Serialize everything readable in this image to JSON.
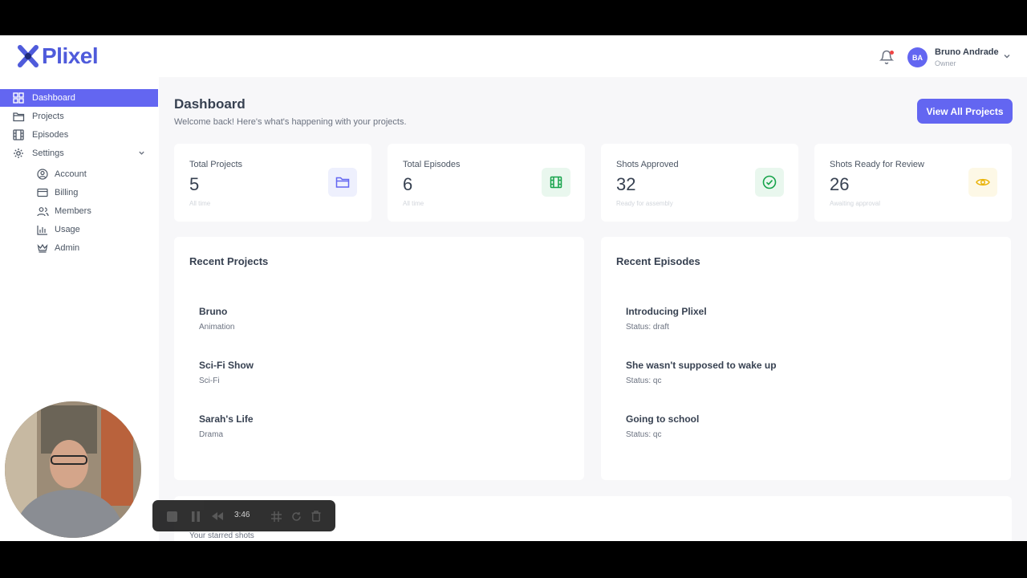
{
  "app": {
    "name": "Plixel",
    "brand_color": "#4f5bdb",
    "accent": "#6366f1"
  },
  "header": {
    "user": {
      "initials": "BA",
      "name": "Bruno Andrade",
      "role": "Owner"
    },
    "icons": [
      "bell-icon",
      "chevron-down-icon"
    ]
  },
  "sidebar": {
    "items": [
      {
        "label": "Dashboard",
        "icon": "dashboard-grid-icon",
        "active": true
      },
      {
        "label": "Projects",
        "icon": "folder-icon"
      },
      {
        "label": "Episodes",
        "icon": "film-icon"
      },
      {
        "label": "Settings",
        "icon": "gear-icon",
        "expanded": true
      }
    ],
    "settings_items": [
      {
        "label": "Account",
        "icon": "user-circle-icon"
      },
      {
        "label": "Billing",
        "icon": "credit-card-icon"
      },
      {
        "label": "Members",
        "icon": "users-icon"
      },
      {
        "label": "Usage",
        "icon": "bar-chart-icon"
      },
      {
        "label": "Admin",
        "icon": "crown-icon"
      }
    ]
  },
  "page": {
    "title": "Dashboard",
    "subtitle": "Welcome back! Here's what's happening with your projects.",
    "view_all_label": "View All Projects"
  },
  "stats": [
    {
      "label": "Total Projects",
      "value": "5",
      "note": "All time",
      "icon": "folder-icon",
      "color": "#6366f1"
    },
    {
      "label": "Total Episodes",
      "value": "6",
      "note": "All time",
      "icon": "film-icon",
      "color": "#16a34a"
    },
    {
      "label": "Shots Approved",
      "value": "32",
      "note": "Ready for assembly",
      "icon": "check-circle-icon",
      "color": "#16a34a"
    },
    {
      "label": "Shots Ready for Review",
      "value": "26",
      "note": "Awaiting approval",
      "icon": "eye-icon",
      "color": "#eab308"
    }
  ],
  "recent_projects": {
    "title": "Recent Projects",
    "items": [
      {
        "name": "Bruno",
        "sub": "Animation"
      },
      {
        "name": "Sci-Fi Show",
        "sub": "Sci-Fi"
      },
      {
        "name": "Sarah's Life",
        "sub": "Drama"
      }
    ]
  },
  "recent_episodes": {
    "title": "Recent Episodes",
    "items": [
      {
        "name": "Introducing Plixel",
        "sub": "Status: draft"
      },
      {
        "name": "She wasn't supposed to wake up",
        "sub": "Status: qc"
      },
      {
        "name": "Going to school",
        "sub": "Status: qc"
      }
    ]
  },
  "starred": {
    "subtitle": "Your starred shots"
  },
  "recorder": {
    "time": "3:46"
  }
}
